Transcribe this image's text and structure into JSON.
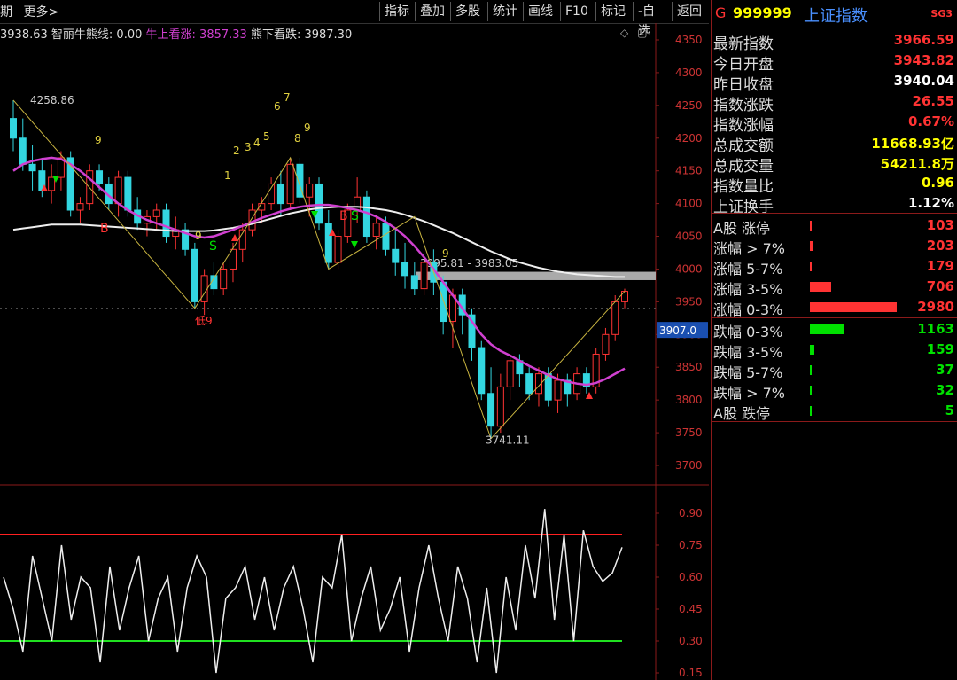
{
  "toolbar": {
    "left": [
      "期",
      "更多>"
    ],
    "buttons": [
      "指标",
      "叠加",
      "多股",
      "统计",
      "画线",
      "F10",
      "标记",
      "-自选",
      "返回"
    ]
  },
  "info": {
    "prefix": "3938.63",
    "name": "智丽牛熊线: 0.00",
    "bull_label": "牛上看涨:",
    "bull_value": "3857.33",
    "bear": "熊下看跌: 3987.30"
  },
  "header": {
    "g": "G",
    "code": "999999",
    "name": "上证指数",
    "badge": "SG3"
  },
  "stats": [
    {
      "label": "最新指数",
      "value": "3966.59",
      "color": "#ff3333"
    },
    {
      "label": "今日开盘",
      "value": "3943.82",
      "color": "#ff3333"
    },
    {
      "label": "昨日收盘",
      "value": "3940.04",
      "color": "#ffffff"
    },
    {
      "label": "指数涨跌",
      "value": "26.55",
      "color": "#ff3333"
    },
    {
      "label": "指数涨幅",
      "value": "0.67%",
      "color": "#ff3333"
    },
    {
      "label": "总成交额",
      "value": "11668.93亿",
      "color": "#ffff00"
    },
    {
      "label": "总成交量",
      "value": "54211.8万",
      "color": "#ffff00"
    },
    {
      "label": "指数量比",
      "value": "0.96",
      "color": "#ffff00"
    },
    {
      "label": "上证换手",
      "value": "1.12%",
      "color": "#ffffff"
    }
  ],
  "breadth": [
    {
      "label": "A股 涨停",
      "value": "103",
      "bar_fraction": 0.01,
      "color": "#ff3333"
    },
    {
      "label": "涨幅 > 7%",
      "value": "203",
      "bar_fraction": 0.03,
      "color": "#ff3333"
    },
    {
      "label": "涨幅 5-7%",
      "value": "179",
      "bar_fraction": 0.02,
      "color": "#ff3333"
    },
    {
      "label": "涨幅 3-5%",
      "value": "706",
      "bar_fraction": 0.24,
      "color": "#ff3333"
    },
    {
      "label": "涨幅 0-3%",
      "value": "2980",
      "bar_fraction": 1.0,
      "color": "#ff3333"
    },
    {
      "label": "跌幅 0-3%",
      "value": "1163",
      "bar_fraction": 0.39,
      "color": "#00e000"
    },
    {
      "label": "跌幅 3-5%",
      "value": "159",
      "bar_fraction": 0.05,
      "color": "#00e000"
    },
    {
      "label": "跌幅 5-7%",
      "value": "37",
      "bar_fraction": 0.01,
      "color": "#00e000"
    },
    {
      "label": "跌幅 > 7%",
      "value": "32",
      "bar_fraction": 0.01,
      "color": "#00e000"
    },
    {
      "label": "A股 跌停",
      "value": "5",
      "bar_fraction": 0.005,
      "color": "#00e000"
    }
  ],
  "chart_data": [
    {
      "type": "candlestick",
      "price_axis_ticks": [
        "4350",
        "4300",
        "4250",
        "4200",
        "4150",
        "4100",
        "4050",
        "4000",
        "3950",
        "3900",
        "3850",
        "3800",
        "3750",
        "3700"
      ],
      "ylim": [
        3700,
        4350
      ],
      "current_price_label": "3907.0",
      "annotations": {
        "high": "4258.86",
        "low": "3741.11",
        "range": "3995.81 - 3983.05",
        "low_mark": "低9",
        "td_counts": [
          "9",
          "1",
          "2",
          "3",
          "4",
          "5",
          "6",
          "7",
          "8",
          "9",
          "9",
          "9"
        ],
        "signals": [
          "B",
          "S",
          "B",
          "S"
        ]
      },
      "candles": [
        [
          4230,
          4258,
          4180,
          4200
        ],
        [
          4200,
          4230,
          4150,
          4160
        ],
        [
          4160,
          4190,
          4120,
          4150
        ],
        [
          4150,
          4170,
          4110,
          4120
        ],
        [
          4120,
          4160,
          4100,
          4140
        ],
        [
          4140,
          4180,
          4120,
          4170
        ],
        [
          4170,
          4180,
          4080,
          4090
        ],
        [
          4090,
          4110,
          4070,
          4100
        ],
        [
          4100,
          4160,
          4090,
          4150
        ],
        [
          4150,
          4160,
          4120,
          4130
        ],
        [
          4130,
          4140,
          4090,
          4100
        ],
        [
          4100,
          4150,
          4080,
          4140
        ],
        [
          4140,
          4150,
          4080,
          4090
        ],
        [
          4090,
          4110,
          4060,
          4070
        ],
        [
          4070,
          4090,
          4050,
          4080
        ],
        [
          4080,
          4100,
          4060,
          4090
        ],
        [
          4090,
          4100,
          4040,
          4050
        ],
        [
          4050,
          4080,
          4030,
          4060
        ],
        [
          4060,
          4070,
          4020,
          4030
        ],
        [
          4030,
          4040,
          3940,
          3950
        ],
        [
          3950,
          4000,
          3930,
          3990
        ],
        [
          3990,
          4010,
          3960,
          3970
        ],
        [
          3970,
          4010,
          3960,
          4000
        ],
        [
          4000,
          4040,
          3980,
          4030
        ],
        [
          4030,
          4070,
          4010,
          4060
        ],
        [
          4060,
          4100,
          4050,
          4090
        ],
        [
          4090,
          4110,
          4070,
          4100
        ],
        [
          4100,
          4140,
          4090,
          4130
        ],
        [
          4130,
          4150,
          4080,
          4100
        ],
        [
          4100,
          4170,
          4090,
          4160
        ],
        [
          4160,
          4170,
          4100,
          4110
        ],
        [
          4110,
          4140,
          4080,
          4130
        ],
        [
          4130,
          4140,
          4060,
          4070
        ],
        [
          4070,
          4090,
          4000,
          4010
        ],
        [
          4010,
          4060,
          4000,
          4050
        ],
        [
          4050,
          4100,
          4040,
          4090
        ],
        [
          4090,
          4140,
          4070,
          4110
        ],
        [
          4110,
          4120,
          4040,
          4050
        ],
        [
          4050,
          4080,
          4030,
          4070
        ],
        [
          4070,
          4080,
          4020,
          4030
        ],
        [
          4030,
          4060,
          3990,
          4010
        ],
        [
          4010,
          4040,
          3970,
          3990
        ],
        [
          3990,
          4010,
          3960,
          3970
        ],
        [
          3970,
          4020,
          3960,
          4010
        ],
        [
          4010,
          4030,
          3960,
          3980
        ],
        [
          3980,
          3990,
          3900,
          3920
        ],
        [
          3920,
          3970,
          3880,
          3960
        ],
        [
          3960,
          3970,
          3900,
          3930
        ],
        [
          3930,
          3940,
          3860,
          3880
        ],
        [
          3880,
          3890,
          3800,
          3810
        ],
        [
          3810,
          3850,
          3741,
          3760
        ],
        [
          3760,
          3840,
          3750,
          3820
        ],
        [
          3820,
          3870,
          3800,
          3860
        ],
        [
          3860,
          3870,
          3820,
          3840
        ],
        [
          3840,
          3850,
          3800,
          3810
        ],
        [
          3810,
          3850,
          3790,
          3840
        ],
        [
          3840,
          3850,
          3790,
          3800
        ],
        [
          3800,
          3840,
          3780,
          3830
        ],
        [
          3830,
          3840,
          3790,
          3810
        ],
        [
          3810,
          3850,
          3800,
          3840
        ],
        [
          3840,
          3850,
          3810,
          3820
        ],
        [
          3820,
          3880,
          3810,
          3870
        ],
        [
          3870,
          3910,
          3860,
          3900
        ],
        [
          3900,
          3960,
          3890,
          3950
        ],
        [
          3950,
          3970,
          3940,
          3966
        ]
      ],
      "ma_fast": [
        4150,
        4160,
        4165,
        4168,
        4170,
        4168,
        4160,
        4150,
        4138,
        4125,
        4112,
        4100,
        4090,
        4082,
        4075,
        4070,
        4065,
        4060,
        4055,
        4050,
        4048,
        4050,
        4055,
        4060,
        4066,
        4072,
        4078,
        4083,
        4088,
        4092,
        4095,
        4097,
        4098,
        4098,
        4096,
        4093,
        4090,
        4086,
        4080,
        4072,
        4062,
        4050,
        4035,
        4018,
        4000,
        3980,
        3960,
        3940,
        3920,
        3900,
        3885,
        3875,
        3868,
        3860,
        3852,
        3845,
        3838,
        3832,
        3828,
        3825,
        3823,
        3826,
        3832,
        3840,
        3848
      ],
      "ma_slow": [
        4060,
        4062,
        4064,
        4066,
        4068,
        4068,
        4068,
        4068,
        4067,
        4066,
        4065,
        4064,
        4063,
        4062,
        4061,
        4060,
        4059,
        4058,
        4058,
        4058,
        4058,
        4059,
        4061,
        4063,
        4066,
        4069,
        4073,
        4077,
        4081,
        4085,
        4088,
        4091,
        4093,
        4094,
        4095,
        4095,
        4095,
        4094,
        4092,
        4090,
        4087,
        4083,
        4078,
        4073,
        4067,
        4061,
        4055,
        4048,
        4041,
        4034,
        4027,
        4021,
        4015,
        4010,
        4006,
        4002,
        3999,
        3996,
        3994,
        3992,
        3991,
        3990,
        3989,
        3988,
        3988
      ]
    },
    {
      "type": "line",
      "ylim": [
        0.15,
        0.95
      ],
      "axis_ticks": [
        "0.90",
        "0.75",
        "0.60",
        "0.45",
        "0.30",
        "0.15"
      ],
      "upper_level": 0.8,
      "lower_level": 0.3,
      "values": [
        0.6,
        0.45,
        0.25,
        0.7,
        0.5,
        0.3,
        0.75,
        0.4,
        0.6,
        0.55,
        0.2,
        0.65,
        0.35,
        0.55,
        0.7,
        0.3,
        0.5,
        0.6,
        0.25,
        0.55,
        0.7,
        0.6,
        0.15,
        0.5,
        0.55,
        0.65,
        0.4,
        0.6,
        0.35,
        0.55,
        0.65,
        0.45,
        0.2,
        0.6,
        0.55,
        0.8,
        0.3,
        0.5,
        0.65,
        0.35,
        0.45,
        0.6,
        0.25,
        0.55,
        0.75,
        0.5,
        0.3,
        0.65,
        0.5,
        0.2,
        0.55,
        0.15,
        0.6,
        0.35,
        0.75,
        0.5,
        0.92,
        0.4,
        0.8,
        0.3,
        0.82,
        0.65,
        0.58,
        0.62,
        0.74
      ]
    }
  ]
}
